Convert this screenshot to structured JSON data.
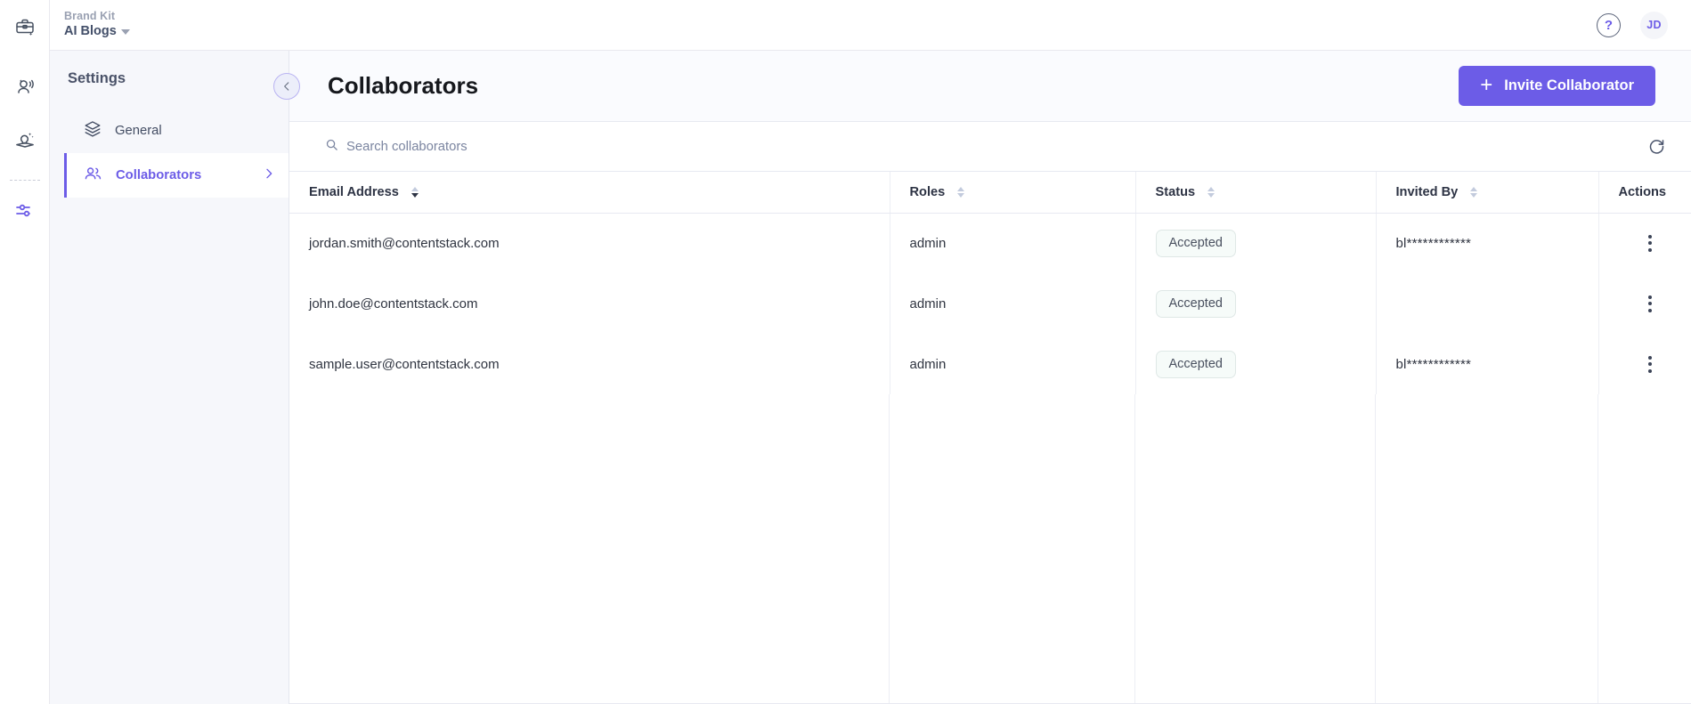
{
  "rail": {
    "items": [
      {
        "name": "briefcase-sparkle-icon",
        "label": "Brand Kit",
        "active": false
      },
      {
        "name": "persona-audio-icon",
        "label": "Personas",
        "active": false
      },
      {
        "name": "idea-sparkle-icon",
        "label": "Insights",
        "active": false
      },
      {
        "name": "sliders-icon",
        "label": "Settings",
        "active": true
      }
    ]
  },
  "topbar": {
    "brand_kit_label": "Brand Kit",
    "brand_name": "AI Blogs",
    "help_glyph": "?",
    "avatar_initials": "JD"
  },
  "sidebar": {
    "title": "Settings",
    "items": [
      {
        "label": "General",
        "icon": "layers-icon",
        "active": false
      },
      {
        "label": "Collaborators",
        "icon": "users-icon",
        "active": true
      }
    ]
  },
  "page": {
    "title": "Collaborators",
    "back_label": "Back",
    "invite_button": "Invite Collaborator",
    "invite_plus": "+",
    "accent_color": "#6c5ce7"
  },
  "search": {
    "placeholder": "Search collaborators",
    "value": "",
    "refresh_label": "Refresh"
  },
  "table": {
    "columns": [
      {
        "label": "Email Address",
        "sortable": true,
        "sort": "desc"
      },
      {
        "label": "Roles",
        "sortable": true,
        "sort": "none"
      },
      {
        "label": "Status",
        "sortable": true,
        "sort": "none"
      },
      {
        "label": "Invited By",
        "sortable": true,
        "sort": "none"
      },
      {
        "label": "Actions",
        "sortable": false,
        "sort": "none"
      }
    ],
    "rows": [
      {
        "email": "jordan.smith@contentstack.com",
        "role": "admin",
        "status": "Accepted",
        "invited_by": "bl************"
      },
      {
        "email": "john.doe@contentstack.com",
        "role": "admin",
        "status": "Accepted",
        "invited_by": ""
      },
      {
        "email": "sample.user@contentstack.com",
        "role": "admin",
        "status": "Accepted",
        "invited_by": "bl************"
      }
    ]
  }
}
